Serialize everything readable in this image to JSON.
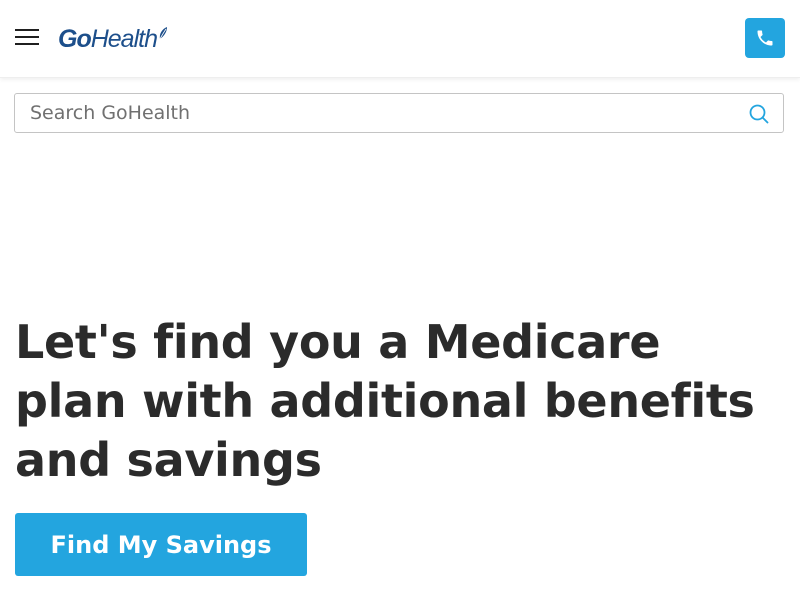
{
  "header": {
    "menu_icon": "hamburger-menu-icon",
    "logo": {
      "part1": "Go",
      "part2": "Health"
    },
    "phone_icon": "phone-icon"
  },
  "search": {
    "placeholder": "Search GoHealth",
    "value": "",
    "icon": "search-icon"
  },
  "hero": {
    "headline": "Let's find you a Medicare plan with additional benefits and savings",
    "cta_label": "Find My Savings"
  },
  "colors": {
    "accent": "#23a5df",
    "brand": "#1d4f8b",
    "text": "#2b2b2b"
  }
}
